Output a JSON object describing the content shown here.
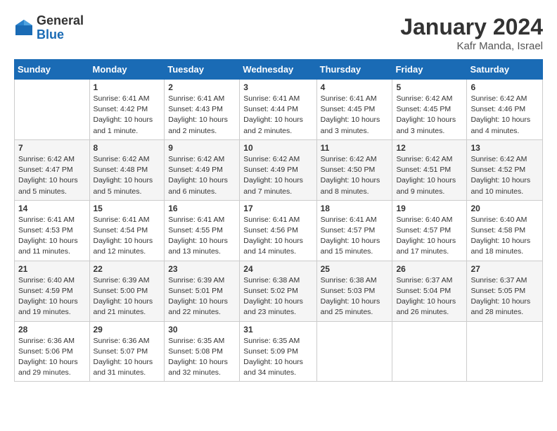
{
  "header": {
    "logo_general": "General",
    "logo_blue": "Blue",
    "month_year": "January 2024",
    "location": "Kafr Manda, Israel"
  },
  "days_of_week": [
    "Sunday",
    "Monday",
    "Tuesday",
    "Wednesday",
    "Thursday",
    "Friday",
    "Saturday"
  ],
  "weeks": [
    [
      {
        "day": "",
        "content": ""
      },
      {
        "day": "1",
        "content": "Sunrise: 6:41 AM\nSunset: 4:42 PM\nDaylight: 10 hours\nand 1 minute."
      },
      {
        "day": "2",
        "content": "Sunrise: 6:41 AM\nSunset: 4:43 PM\nDaylight: 10 hours\nand 2 minutes."
      },
      {
        "day": "3",
        "content": "Sunrise: 6:41 AM\nSunset: 4:44 PM\nDaylight: 10 hours\nand 2 minutes."
      },
      {
        "day": "4",
        "content": "Sunrise: 6:41 AM\nSunset: 4:45 PM\nDaylight: 10 hours\nand 3 minutes."
      },
      {
        "day": "5",
        "content": "Sunrise: 6:42 AM\nSunset: 4:45 PM\nDaylight: 10 hours\nand 3 minutes."
      },
      {
        "day": "6",
        "content": "Sunrise: 6:42 AM\nSunset: 4:46 PM\nDaylight: 10 hours\nand 4 minutes."
      }
    ],
    [
      {
        "day": "7",
        "content": "Sunrise: 6:42 AM\nSunset: 4:47 PM\nDaylight: 10 hours\nand 5 minutes."
      },
      {
        "day": "8",
        "content": "Sunrise: 6:42 AM\nSunset: 4:48 PM\nDaylight: 10 hours\nand 5 minutes."
      },
      {
        "day": "9",
        "content": "Sunrise: 6:42 AM\nSunset: 4:49 PM\nDaylight: 10 hours\nand 6 minutes."
      },
      {
        "day": "10",
        "content": "Sunrise: 6:42 AM\nSunset: 4:49 PM\nDaylight: 10 hours\nand 7 minutes."
      },
      {
        "day": "11",
        "content": "Sunrise: 6:42 AM\nSunset: 4:50 PM\nDaylight: 10 hours\nand 8 minutes."
      },
      {
        "day": "12",
        "content": "Sunrise: 6:42 AM\nSunset: 4:51 PM\nDaylight: 10 hours\nand 9 minutes."
      },
      {
        "day": "13",
        "content": "Sunrise: 6:42 AM\nSunset: 4:52 PM\nDaylight: 10 hours\nand 10 minutes."
      }
    ],
    [
      {
        "day": "14",
        "content": "Sunrise: 6:41 AM\nSunset: 4:53 PM\nDaylight: 10 hours\nand 11 minutes."
      },
      {
        "day": "15",
        "content": "Sunrise: 6:41 AM\nSunset: 4:54 PM\nDaylight: 10 hours\nand 12 minutes."
      },
      {
        "day": "16",
        "content": "Sunrise: 6:41 AM\nSunset: 4:55 PM\nDaylight: 10 hours\nand 13 minutes."
      },
      {
        "day": "17",
        "content": "Sunrise: 6:41 AM\nSunset: 4:56 PM\nDaylight: 10 hours\nand 14 minutes."
      },
      {
        "day": "18",
        "content": "Sunrise: 6:41 AM\nSunset: 4:57 PM\nDaylight: 10 hours\nand 15 minutes."
      },
      {
        "day": "19",
        "content": "Sunrise: 6:40 AM\nSunset: 4:57 PM\nDaylight: 10 hours\nand 17 minutes."
      },
      {
        "day": "20",
        "content": "Sunrise: 6:40 AM\nSunset: 4:58 PM\nDaylight: 10 hours\nand 18 minutes."
      }
    ],
    [
      {
        "day": "21",
        "content": "Sunrise: 6:40 AM\nSunset: 4:59 PM\nDaylight: 10 hours\nand 19 minutes."
      },
      {
        "day": "22",
        "content": "Sunrise: 6:39 AM\nSunset: 5:00 PM\nDaylight: 10 hours\nand 21 minutes."
      },
      {
        "day": "23",
        "content": "Sunrise: 6:39 AM\nSunset: 5:01 PM\nDaylight: 10 hours\nand 22 minutes."
      },
      {
        "day": "24",
        "content": "Sunrise: 6:38 AM\nSunset: 5:02 PM\nDaylight: 10 hours\nand 23 minutes."
      },
      {
        "day": "25",
        "content": "Sunrise: 6:38 AM\nSunset: 5:03 PM\nDaylight: 10 hours\nand 25 minutes."
      },
      {
        "day": "26",
        "content": "Sunrise: 6:37 AM\nSunset: 5:04 PM\nDaylight: 10 hours\nand 26 minutes."
      },
      {
        "day": "27",
        "content": "Sunrise: 6:37 AM\nSunset: 5:05 PM\nDaylight: 10 hours\nand 28 minutes."
      }
    ],
    [
      {
        "day": "28",
        "content": "Sunrise: 6:36 AM\nSunset: 5:06 PM\nDaylight: 10 hours\nand 29 minutes."
      },
      {
        "day": "29",
        "content": "Sunrise: 6:36 AM\nSunset: 5:07 PM\nDaylight: 10 hours\nand 31 minutes."
      },
      {
        "day": "30",
        "content": "Sunrise: 6:35 AM\nSunset: 5:08 PM\nDaylight: 10 hours\nand 32 minutes."
      },
      {
        "day": "31",
        "content": "Sunrise: 6:35 AM\nSunset: 5:09 PM\nDaylight: 10 hours\nand 34 minutes."
      },
      {
        "day": "",
        "content": ""
      },
      {
        "day": "",
        "content": ""
      },
      {
        "day": "",
        "content": ""
      }
    ]
  ]
}
